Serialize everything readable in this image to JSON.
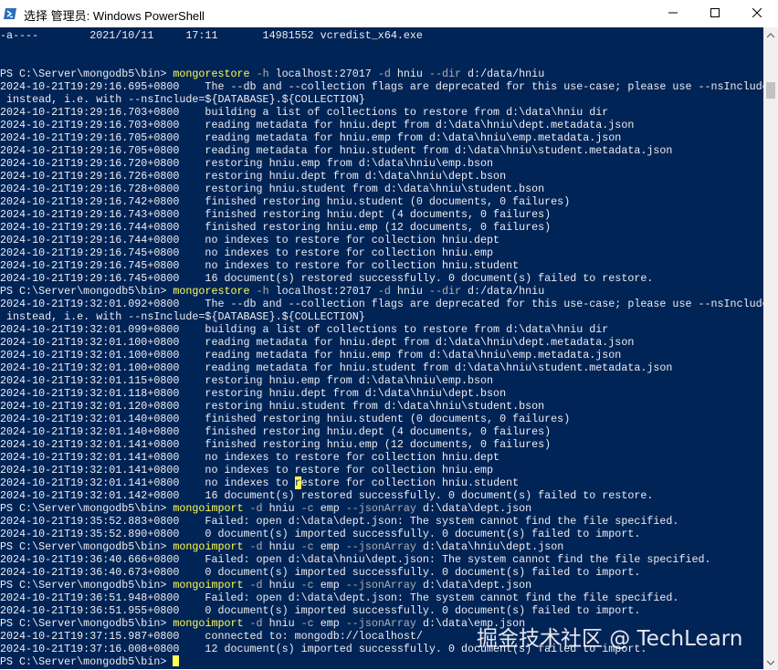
{
  "window": {
    "title": "选择 管理员: Windows PowerShell",
    "icons": {
      "app": "powershell-icon",
      "minimize": "minimize-icon",
      "maximize": "maximize-icon",
      "close": "close-icon"
    }
  },
  "colors": {
    "console_bg": "#012456",
    "text": "#eeedf0",
    "command": "#fefd55",
    "flag": "#b0b0b0"
  },
  "watermark": "掘金技术社区 @ TechLearn",
  "console": {
    "lines": [
      {
        "segs": [
          {
            "t": "-a----        2021/10/11     17:11       14981552 vcredist_x64.exe"
          }
        ]
      },
      {
        "segs": [
          {
            "t": ""
          }
        ]
      },
      {
        "segs": [
          {
            "t": ""
          }
        ]
      },
      {
        "segs": [
          {
            "t": "PS C:\\Server\\mongodb5\\bin> "
          },
          {
            "t": "mongorestore",
            "c": "cmd"
          },
          {
            "t": " "
          },
          {
            "t": "-h",
            "c": "flag"
          },
          {
            "t": " localhost:27017 "
          },
          {
            "t": "-d",
            "c": "flag"
          },
          {
            "t": " hniu "
          },
          {
            "t": "--dir",
            "c": "flag"
          },
          {
            "t": " d:/data/hniu"
          }
        ]
      },
      {
        "segs": [
          {
            "t": "2024-10-21T19:29:16.695+0800    The --db and --collection flags are deprecated for this use-case; please use --nsInclude"
          }
        ]
      },
      {
        "segs": [
          {
            "t": " instead, i.e. with --nsInclude=${DATABASE}.${COLLECTION}"
          }
        ]
      },
      {
        "segs": [
          {
            "t": "2024-10-21T19:29:16.703+0800    building a list of collections to restore from d:\\data\\hniu dir"
          }
        ]
      },
      {
        "segs": [
          {
            "t": "2024-10-21T19:29:16.703+0800    reading metadata for hniu.dept from d:\\data\\hniu\\dept.metadata.json"
          }
        ]
      },
      {
        "segs": [
          {
            "t": "2024-10-21T19:29:16.705+0800    reading metadata for hniu.emp from d:\\data\\hniu\\emp.metadata.json"
          }
        ]
      },
      {
        "segs": [
          {
            "t": "2024-10-21T19:29:16.705+0800    reading metadata for hniu.student from d:\\data\\hniu\\student.metadata.json"
          }
        ]
      },
      {
        "segs": [
          {
            "t": "2024-10-21T19:29:16.720+0800    restoring hniu.emp from d:\\data\\hniu\\emp.bson"
          }
        ]
      },
      {
        "segs": [
          {
            "t": "2024-10-21T19:29:16.726+0800    restoring hniu.dept from d:\\data\\hniu\\dept.bson"
          }
        ]
      },
      {
        "segs": [
          {
            "t": "2024-10-21T19:29:16.728+0800    restoring hniu.student from d:\\data\\hniu\\student.bson"
          }
        ]
      },
      {
        "segs": [
          {
            "t": "2024-10-21T19:29:16.742+0800    finished restoring hniu.student (0 documents, 0 failures)"
          }
        ]
      },
      {
        "segs": [
          {
            "t": "2024-10-21T19:29:16.743+0800    finished restoring hniu.dept (4 documents, 0 failures)"
          }
        ]
      },
      {
        "segs": [
          {
            "t": "2024-10-21T19:29:16.744+0800    finished restoring hniu.emp (12 documents, 0 failures)"
          }
        ]
      },
      {
        "segs": [
          {
            "t": "2024-10-21T19:29:16.744+0800    no indexes to restore for collection hniu.dept"
          }
        ]
      },
      {
        "segs": [
          {
            "t": "2024-10-21T19:29:16.745+0800    no indexes to restore for collection hniu.emp"
          }
        ]
      },
      {
        "segs": [
          {
            "t": "2024-10-21T19:29:16.745+0800    no indexes to restore for collection hniu.student"
          }
        ]
      },
      {
        "segs": [
          {
            "t": "2024-10-21T19:29:16.745+0800    16 document(s) restored successfully. 0 document(s) failed to restore."
          }
        ]
      },
      {
        "segs": [
          {
            "t": "PS C:\\Server\\mongodb5\\bin> "
          },
          {
            "t": "mongorestore",
            "c": "cmd"
          },
          {
            "t": " "
          },
          {
            "t": "-h",
            "c": "flag"
          },
          {
            "t": " localhost:27017 "
          },
          {
            "t": "-d",
            "c": "flag"
          },
          {
            "t": " hniu "
          },
          {
            "t": "--dir",
            "c": "flag"
          },
          {
            "t": " d:/data/hniu"
          }
        ]
      },
      {
        "segs": [
          {
            "t": "2024-10-21T19:32:01.092+0800    The --db and --collection flags are deprecated for this use-case; please use --nsInclude"
          }
        ]
      },
      {
        "segs": [
          {
            "t": " instead, i.e. with --nsInclude=${DATABASE}.${COLLECTION}"
          }
        ]
      },
      {
        "segs": [
          {
            "t": "2024-10-21T19:32:01.099+0800    building a list of collections to restore from d:\\data\\hniu dir"
          }
        ]
      },
      {
        "segs": [
          {
            "t": "2024-10-21T19:32:01.100+0800    reading metadata for hniu.dept from d:\\data\\hniu\\dept.metadata.json"
          }
        ]
      },
      {
        "segs": [
          {
            "t": "2024-10-21T19:32:01.100+0800    reading metadata for hniu.emp from d:\\data\\hniu\\emp.metadata.json"
          }
        ]
      },
      {
        "segs": [
          {
            "t": "2024-10-21T19:32:01.100+0800    reading metadata for hniu.student from d:\\data\\hniu\\student.metadata.json"
          }
        ]
      },
      {
        "segs": [
          {
            "t": "2024-10-21T19:32:01.115+0800    restoring hniu.emp from d:\\data\\hniu\\emp.bson"
          }
        ]
      },
      {
        "segs": [
          {
            "t": "2024-10-21T19:32:01.118+0800    restoring hniu.dept from d:\\data\\hniu\\dept.bson"
          }
        ]
      },
      {
        "segs": [
          {
            "t": "2024-10-21T19:32:01.120+0800    restoring hniu.student from d:\\data\\hniu\\student.bson"
          }
        ]
      },
      {
        "segs": [
          {
            "t": "2024-10-21T19:32:01.140+0800    finished restoring hniu.student (0 documents, 0 failures)"
          }
        ]
      },
      {
        "segs": [
          {
            "t": "2024-10-21T19:32:01.140+0800    finished restoring hniu.dept (4 documents, 0 failures)"
          }
        ]
      },
      {
        "segs": [
          {
            "t": "2024-10-21T19:32:01.141+0800    finished restoring hniu.emp (12 documents, 0 failures)"
          }
        ]
      },
      {
        "segs": [
          {
            "t": "2024-10-21T19:32:01.141+0800    no indexes to restore for collection hniu.dept"
          }
        ]
      },
      {
        "segs": [
          {
            "t": "2024-10-21T19:32:01.141+0800    no indexes to restore for collection hniu.emp"
          }
        ]
      },
      {
        "segs": [
          {
            "t": "2024-10-21T19:32:01.141+0800    no indexes to "
          },
          {
            "t": "r",
            "c": "caret-inline"
          },
          {
            "t": "estore for collection hniu.student"
          }
        ]
      },
      {
        "segs": [
          {
            "t": "2024-10-21T19:32:01.142+0800    16 document(s) restored successfully. 0 document(s) failed to restore."
          }
        ]
      },
      {
        "segs": [
          {
            "t": "PS C:\\Server\\mongodb5\\bin> "
          },
          {
            "t": "mongoimport",
            "c": "cmd"
          },
          {
            "t": " "
          },
          {
            "t": "-d",
            "c": "flag"
          },
          {
            "t": " hniu "
          },
          {
            "t": "-c",
            "c": "flag"
          },
          {
            "t": " emp "
          },
          {
            "t": "--jsonArray",
            "c": "flag"
          },
          {
            "t": " d:\\data\\dept.json"
          }
        ]
      },
      {
        "segs": [
          {
            "t": "2024-10-21T19:35:52.883+0800    Failed: open d:\\data\\dept.json: The system cannot find the file specified."
          }
        ]
      },
      {
        "segs": [
          {
            "t": "2024-10-21T19:35:52.890+0800    0 document(s) imported successfully. 0 document(s) failed to import."
          }
        ]
      },
      {
        "segs": [
          {
            "t": "PS C:\\Server\\mongodb5\\bin> "
          },
          {
            "t": "mongoimport",
            "c": "cmd"
          },
          {
            "t": " "
          },
          {
            "t": "-d",
            "c": "flag"
          },
          {
            "t": " hniu "
          },
          {
            "t": "-c",
            "c": "flag"
          },
          {
            "t": " emp "
          },
          {
            "t": "--jsonArray",
            "c": "flag"
          },
          {
            "t": " d:\\data\\hniu\\dept.json"
          }
        ]
      },
      {
        "segs": [
          {
            "t": "2024-10-21T19:36:40.666+0800    Failed: open d:\\data\\hniu\\dept.json: The system cannot find the file specified."
          }
        ]
      },
      {
        "segs": [
          {
            "t": "2024-10-21T19:36:40.673+0800    0 document(s) imported successfully. 0 document(s) failed to import."
          }
        ]
      },
      {
        "segs": [
          {
            "t": "PS C:\\Server\\mongodb5\\bin> "
          },
          {
            "t": "mongoimport",
            "c": "cmd"
          },
          {
            "t": " "
          },
          {
            "t": "-d",
            "c": "flag"
          },
          {
            "t": " hniu "
          },
          {
            "t": "-c",
            "c": "flag"
          },
          {
            "t": " emp "
          },
          {
            "t": "--jsonArray",
            "c": "flag"
          },
          {
            "t": " d:\\data\\dept.json"
          }
        ]
      },
      {
        "segs": [
          {
            "t": "2024-10-21T19:36:51.948+0800    Failed: open d:\\data\\dept.json: The system cannot find the file specified."
          }
        ]
      },
      {
        "segs": [
          {
            "t": "2024-10-21T19:36:51.955+0800    0 document(s) imported successfully. 0 document(s) failed to import."
          }
        ]
      },
      {
        "segs": [
          {
            "t": "PS C:\\Server\\mongodb5\\bin> "
          },
          {
            "t": "mongoimport",
            "c": "cmd"
          },
          {
            "t": " "
          },
          {
            "t": "-d",
            "c": "flag"
          },
          {
            "t": " hniu "
          },
          {
            "t": "-c",
            "c": "flag"
          },
          {
            "t": " emp "
          },
          {
            "t": "--jsonArray",
            "c": "flag"
          },
          {
            "t": " d:\\data\\emp.json"
          }
        ]
      },
      {
        "segs": [
          {
            "t": "2024-10-21T19:37:15.987+0800    connected to: mongodb://localhost/"
          }
        ]
      },
      {
        "segs": [
          {
            "t": "2024-10-21T19:37:16.008+0800    12 document(s) imported successfully. 0 document(s) failed to import."
          }
        ]
      },
      {
        "segs": [
          {
            "t": "PS C:\\Server\\mongodb5\\bin> "
          }
        ],
        "cursor": true
      }
    ]
  }
}
